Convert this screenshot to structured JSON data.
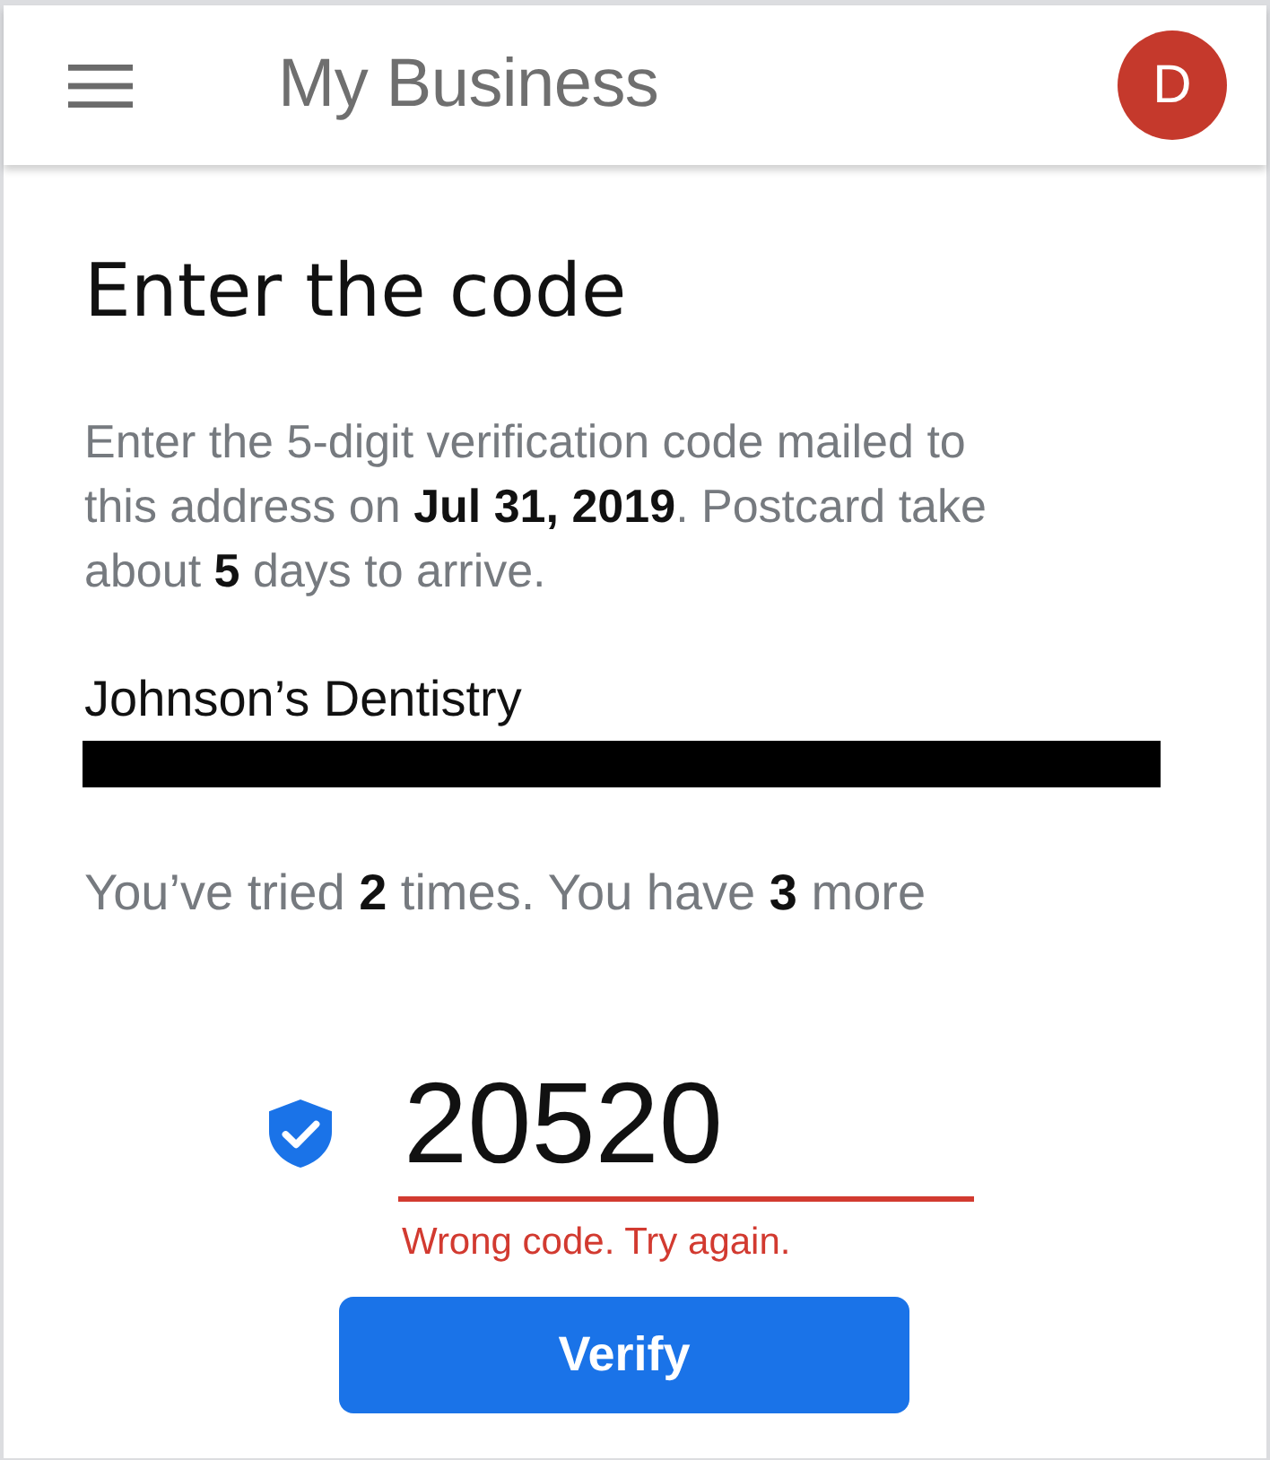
{
  "app_bar": {
    "title": "My Business",
    "avatar": {
      "initial": "D"
    }
  },
  "heading": "Enter the code",
  "instructions": "Enter the 5-digit verification code mailed to this address on **Jul 31, 2019**. Postcard take about **5** days to arrive.",
  "business_name": "Johnson’s Dentistry",
  "attempts": "You’ve tried **2** times. You have **3** more",
  "code_field": {
    "value": "20520",
    "error": "Wrong code. Try again."
  },
  "verify_button": {
    "label": "Verify"
  }
}
